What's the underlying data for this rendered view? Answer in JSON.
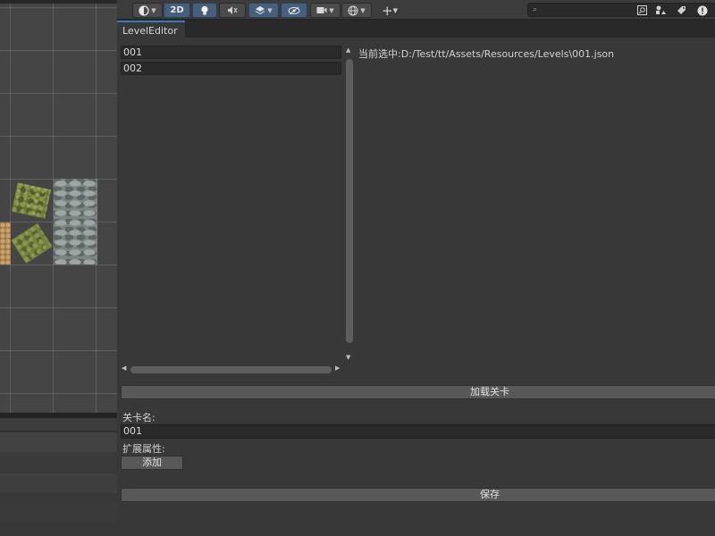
{
  "toolbar": {
    "shading_icon": "sphere-icon",
    "mode_2d_label": "2D",
    "lighting_icon": "lightbulb-icon",
    "audio_icon": "audio-mute-icon",
    "effects_icon": "layers-icon",
    "hidden_icon": "eye-slash-icon",
    "camera_icon": "camera-icon",
    "gizmos_icon": "gizmo-globe-icon",
    "add_icon": "plus-icon",
    "search_icon": "search-icon",
    "search_placeholder": "",
    "right_icons": [
      "search-scene-icon",
      "filter-icon",
      "tag-icon",
      "alert-icon"
    ]
  },
  "window": {
    "tab_title": "LevelEditor"
  },
  "level_list": {
    "items": [
      {
        "label": "001"
      },
      {
        "label": "002"
      }
    ]
  },
  "selection": {
    "path_text": "当前选中:D:/Test/tt/Assets/Resources/Levels\\001.json"
  },
  "actions": {
    "load_label": "加载关卡",
    "save_label": "保存",
    "add_label": "添加"
  },
  "form": {
    "level_name_label": "关卡名:",
    "level_name_value": "001",
    "ext_props_label": "扩展属性:"
  },
  "colors": {
    "accent": "#3a79bb",
    "active_toolbar": "#46607c",
    "panel_bg": "#383838"
  }
}
